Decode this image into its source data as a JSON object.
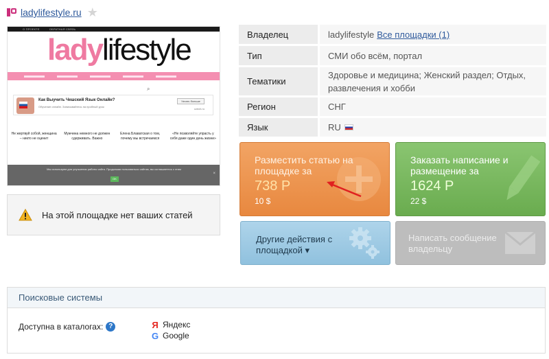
{
  "header": {
    "site_url": "ladylifestyle.ru"
  },
  "thumbnail": {
    "topbar_items": [
      "О ПРОЕКТЕ",
      "ОБРАТНАЯ СВЯЗЬ"
    ],
    "logo_part1": "lady",
    "logo_part2": "lifestyle",
    "ad_title": "Как Выучить Чешский Язык Онлайн?",
    "ad_subtitle": "Обучение онлайн. Записывайтесь на пробный урок",
    "ad_button": "Узнать больше",
    "ad_url": "czech.ru",
    "articles": [
      "Не жертвуй собой, женщина – никто не оценит",
      "Мужчина немного не должен сдерживать. Важно",
      "Елена Блаватская о том, почему мы встречаемся",
      "«Не позволяйте упрасть у себя даже один день жизни»"
    ],
    "cookie_text": "Мы используем для улучшения работы сайта. Продолжая пользоваться сайтом, вы соглашаетесь с этим",
    "cookie_ok": "OK"
  },
  "notice": {
    "text": "На этой площадке нет ваших статей"
  },
  "info": {
    "rows": [
      {
        "key": "Владелец",
        "value": "ladylifestyle",
        "link": "Все площадки (1)"
      },
      {
        "key": "Тип",
        "value": "СМИ обо всём, портал"
      },
      {
        "key": "Тематики",
        "value": "Здоровье и медицина; Женский раздел; Отдых, развлечения и хобби"
      },
      {
        "key": "Регион",
        "value": "СНГ"
      },
      {
        "key": "Язык",
        "value": "RU"
      }
    ]
  },
  "actions": {
    "place_article": {
      "title": "Разместить статью на площадке за",
      "price": "738 Р",
      "sub": "10 $",
      "color": "#ec9149"
    },
    "order_writing": {
      "title": "Заказать написание и размещение за",
      "price": "1624 Р",
      "sub": "22 $",
      "color": "#79b95f"
    },
    "other_actions": {
      "title": "Другие действия с площадкой ▾",
      "color": "#a3cce5"
    },
    "message_owner": {
      "title": "Написать сообщение владельцу",
      "color": "#bdbdbd"
    }
  },
  "engines": {
    "heading": "Поисковые системы",
    "catalog_label": "Доступна в каталогах:",
    "help": "?",
    "list": [
      {
        "icon": "yandex-icon",
        "name": "Яндекс"
      },
      {
        "icon": "google-icon",
        "name": "Google"
      }
    ]
  }
}
